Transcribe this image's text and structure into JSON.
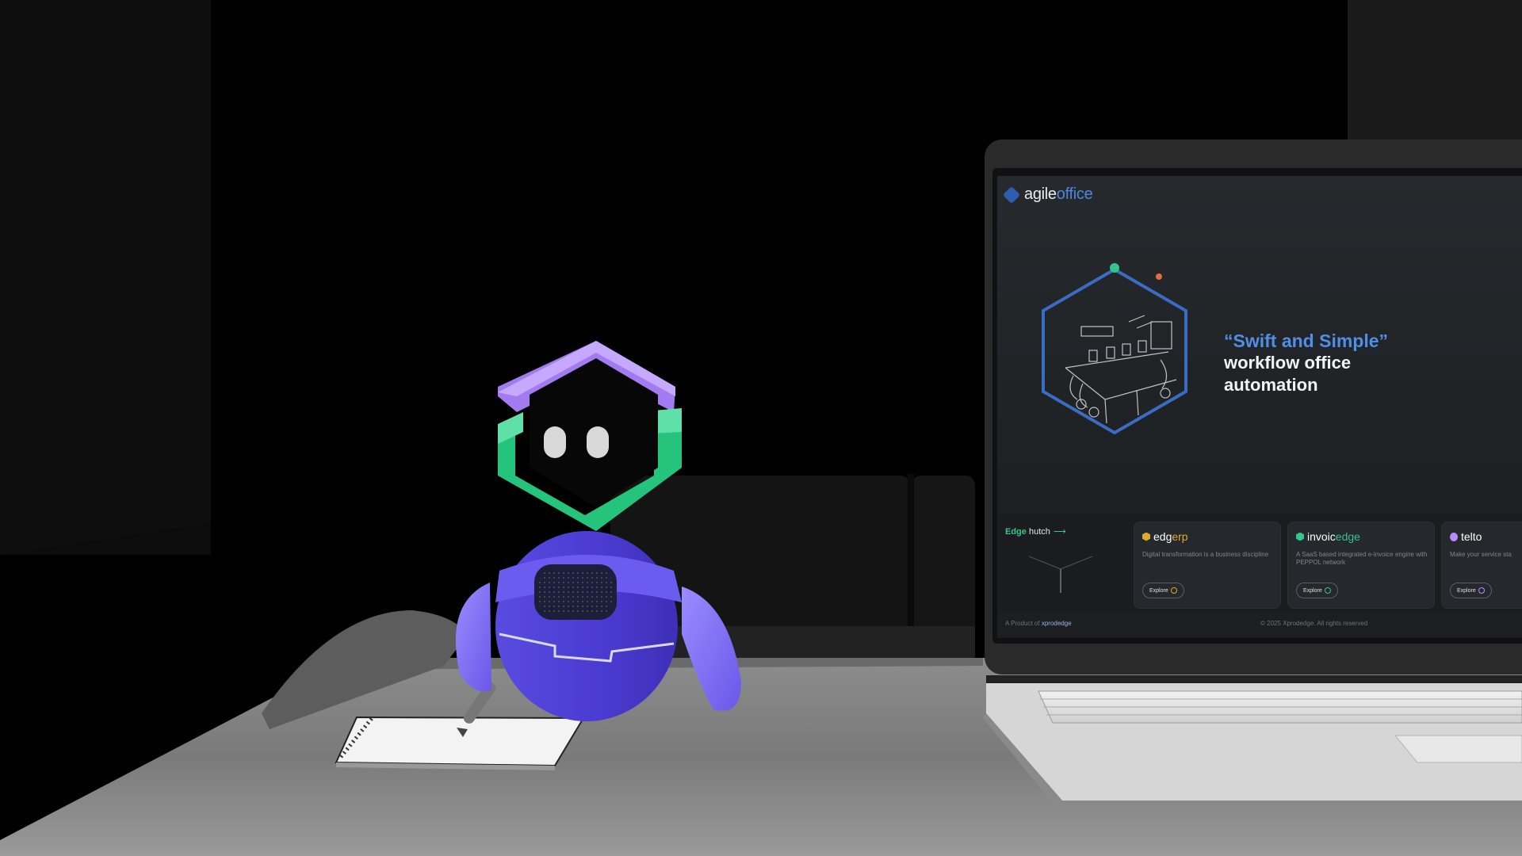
{
  "screen": {
    "logo": {
      "part1": "agile",
      "part2": "office"
    },
    "tagline": {
      "quote": "“Swift and Simple”",
      "main": "workflow office automation"
    },
    "hutch": {
      "edge": "Edge",
      "rest": " hutch",
      "arrow": "⟶"
    },
    "cards": [
      {
        "name_a": "edg",
        "name_b": "erp",
        "color_a": "#ffffff",
        "color_b": "#e0a92a",
        "icon_color": "#e0a92a",
        "desc": "Digital transformation is a business discipline",
        "cta": "Explore"
      },
      {
        "name_a": "invoic",
        "name_b": "edge",
        "color_a": "#ffffff",
        "color_b": "#35c48a",
        "icon_color": "#35c48a",
        "desc": "A SaaS based integrated e-invoice engine with PEPPOL network",
        "cta": "Explore"
      },
      {
        "name_a": "telto",
        "name_b": "",
        "color_a": "#ffffff",
        "color_b": "#b58cff",
        "icon_color": "#b58cff",
        "desc": "Make your service sta",
        "cta": "Explore"
      }
    ],
    "footer": {
      "left": "A Product of",
      "brand": "xprodedge",
      "right": "© 2025 Xprodedge. All rights reserved"
    }
  }
}
